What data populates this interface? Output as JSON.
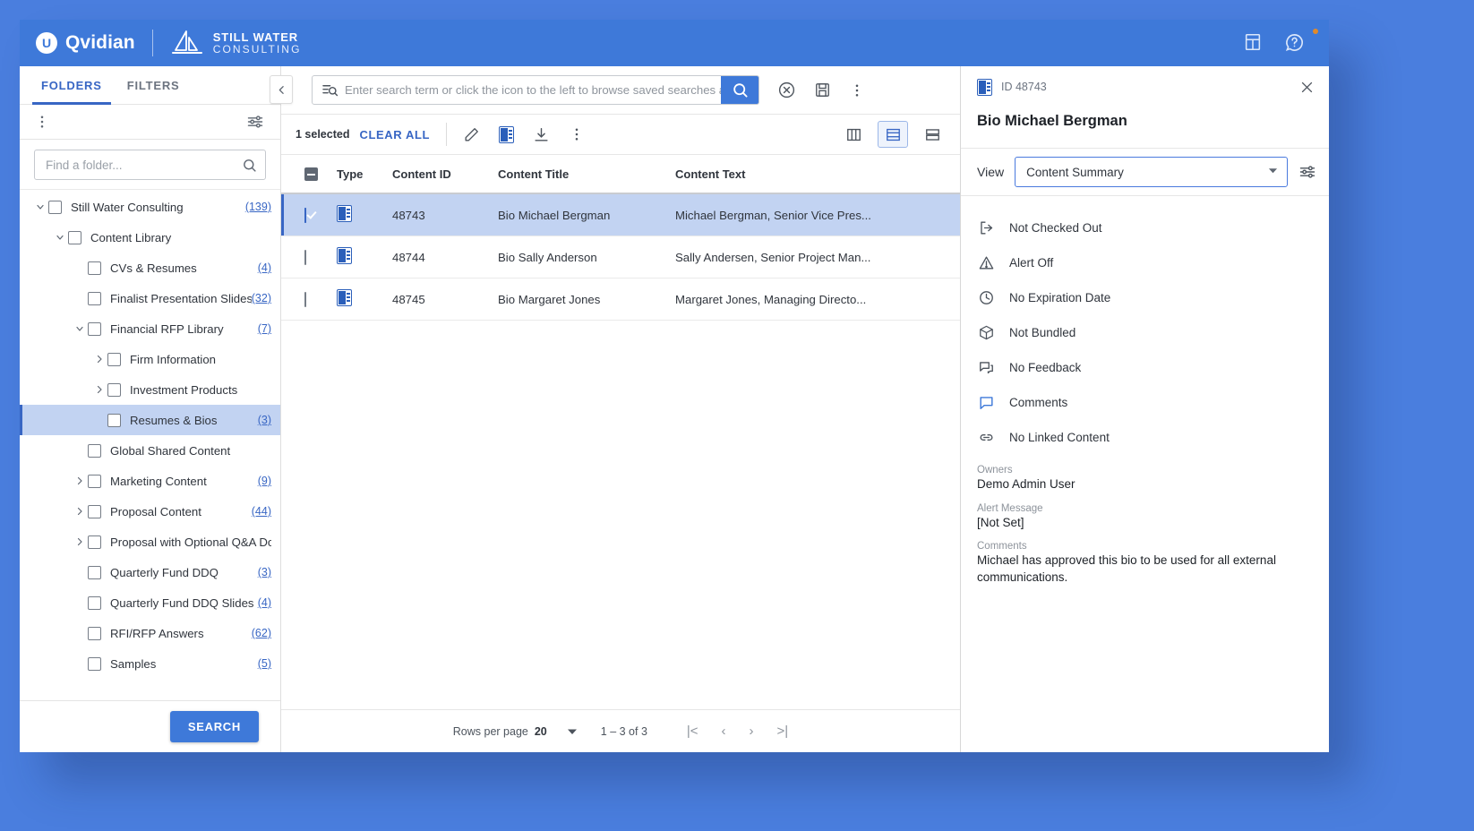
{
  "topbar": {
    "brand_initial": "U",
    "brand_name": "Qvidian",
    "client_line1": "STILL WATER",
    "client_line2": "CONSULTING",
    "dashboard_icon": "dashboard-icon",
    "help_icon": "help-icon"
  },
  "left_panel": {
    "tabs": [
      {
        "label": "FOLDERS",
        "active": true
      },
      {
        "label": "FILTERS",
        "active": false
      }
    ],
    "toolbar": {
      "more_icon": "more-vertical-icon",
      "settings_icon": "tune-icon"
    },
    "folder_search_placeholder": "Find a folder...",
    "search_button": "SEARCH",
    "tree": [
      {
        "label": "Still Water Consulting",
        "count": "(139)",
        "depth": 0,
        "caret": "down",
        "selected": false
      },
      {
        "label": "Content Library",
        "count": "",
        "depth": 1,
        "caret": "down",
        "selected": false
      },
      {
        "label": "CVs & Resumes",
        "count": "(4)",
        "depth": 2,
        "caret": "none",
        "selected": false
      },
      {
        "label": "Finalist Presentation Slides",
        "count": "(32)",
        "depth": 2,
        "caret": "none",
        "selected": false
      },
      {
        "label": "Financial RFP Library",
        "count": "(7)",
        "depth": 2,
        "caret": "down",
        "selected": false
      },
      {
        "label": "Firm Information",
        "count": "",
        "depth": 3,
        "caret": "right",
        "selected": false
      },
      {
        "label": "Investment Products",
        "count": "",
        "depth": 3,
        "caret": "right",
        "selected": false
      },
      {
        "label": "Resumes & Bios",
        "count": "(3)",
        "depth": 3,
        "caret": "none",
        "selected": true
      },
      {
        "label": "Global Shared Content",
        "count": "",
        "depth": 2,
        "caret": "none",
        "selected": false
      },
      {
        "label": "Marketing Content",
        "count": "(9)",
        "depth": 2,
        "caret": "right",
        "selected": false
      },
      {
        "label": "Proposal Content",
        "count": "(44)",
        "depth": 2,
        "caret": "right",
        "selected": false
      },
      {
        "label": "Proposal with Optional Q&A Doc Type",
        "count": "",
        "depth": 2,
        "caret": "right",
        "selected": false
      },
      {
        "label": "Quarterly Fund DDQ",
        "count": "(3)",
        "depth": 2,
        "caret": "none",
        "selected": false
      },
      {
        "label": "Quarterly Fund DDQ Slides",
        "count": "(4)",
        "depth": 2,
        "caret": "none",
        "selected": false
      },
      {
        "label": "RFI/RFP Answers",
        "count": "(62)",
        "depth": 2,
        "caret": "none",
        "selected": false
      },
      {
        "label": "Samples",
        "count": "(5)",
        "depth": 2,
        "caret": "none",
        "selected": false
      }
    ]
  },
  "center_panel": {
    "collapse_icon": "chevron-left-icon",
    "search": {
      "placeholder": "Enter search term or click the icon to the left to browse saved searches and his",
      "value": "",
      "lead_icon": "saved-search-icon",
      "submit_icon": "search-icon"
    },
    "search_row_icons": [
      {
        "name": "clear-search-icon"
      },
      {
        "name": "save-search-icon"
      },
      {
        "name": "more-vertical-icon"
      }
    ],
    "toolbar": {
      "selected_count": "1 selected",
      "clear_all": "CLEAR ALL",
      "edit_icon": "pencil-icon",
      "word_icon": "word-doc-icon",
      "download_icon": "download-icon",
      "more_icon": "more-vertical-icon",
      "view_columns_icon": "columns-view-icon",
      "view_rows_icon": "rows-view-icon",
      "view_split_icon": "split-view-icon"
    },
    "table": {
      "headers": [
        "",
        "Type",
        "Content ID",
        "Content Title",
        "Content Text"
      ],
      "rows": [
        {
          "checked": true,
          "selected": true,
          "type": "word-doc-icon",
          "id": "48743",
          "title": "Bio Michael Bergman",
          "text": "Michael Bergman, Senior Vice Pres..."
        },
        {
          "checked": false,
          "selected": false,
          "type": "word-doc-icon",
          "id": "48744",
          "title": "Bio Sally Anderson",
          "text": "Sally Andersen, Senior Project Man..."
        },
        {
          "checked": false,
          "selected": false,
          "type": "word-doc-icon",
          "id": "48745",
          "title": "Bio Margaret Jones",
          "text": "Margaret Jones, Managing Directo..."
        }
      ]
    },
    "pager": {
      "rows_per_page_label": "Rows per page",
      "rows_per_page_value": "20",
      "range": "1 – 3 of 3",
      "first_icon": "|<",
      "prev_icon": "‹",
      "next_icon": "›",
      "last_icon": ">|"
    }
  },
  "right_panel": {
    "doc_icon": "word-doc-icon",
    "id_label": "ID 48743",
    "close_icon": "close-icon",
    "title": "Bio Michael Bergman",
    "view_label": "View",
    "view_value": "Content Summary",
    "view_caret_icon": "chevron-down-icon",
    "settings_icon": "tune-icon",
    "status_items": [
      {
        "icon": "checkout-icon",
        "label": "Not Checked Out",
        "accent": false
      },
      {
        "icon": "alert-triangle-icon",
        "label": "Alert Off",
        "accent": false
      },
      {
        "icon": "clock-icon",
        "label": "No Expiration Date",
        "accent": false
      },
      {
        "icon": "package-icon",
        "label": "Not Bundled",
        "accent": false
      },
      {
        "icon": "feedback-icon",
        "label": "No Feedback",
        "accent": false
      },
      {
        "icon": "comment-icon",
        "label": "Comments",
        "accent": true
      },
      {
        "icon": "link-icon",
        "label": "No Linked Content",
        "accent": false
      }
    ],
    "meta": [
      {
        "label": "Owners",
        "value": "Demo Admin User"
      },
      {
        "label": "Alert Message",
        "value": "[Not Set]"
      },
      {
        "label": "Comments",
        "value": "Michael has approved this bio to be used for all external communications."
      }
    ]
  },
  "colors": {
    "brand_blue": "#3e79d9",
    "accent_blue": "#3866c4",
    "selection_blue": "#c2d3f2",
    "desktop_blue": "#4a7ede"
  }
}
